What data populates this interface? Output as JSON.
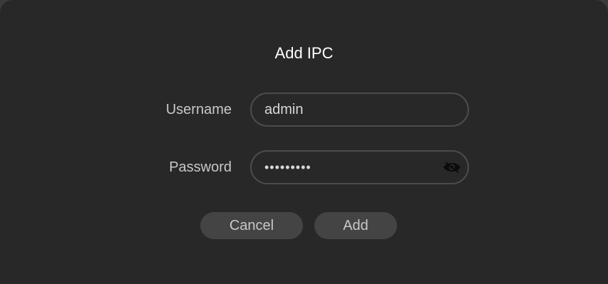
{
  "dialog": {
    "title": "Add IPC",
    "username": {
      "label": "Username",
      "value": "admin"
    },
    "password": {
      "label": "Password",
      "value": "•••••••••",
      "toggle_icon": "eye-hidden-icon"
    },
    "buttons": {
      "cancel_label": "Cancel",
      "add_label": "Add"
    }
  }
}
